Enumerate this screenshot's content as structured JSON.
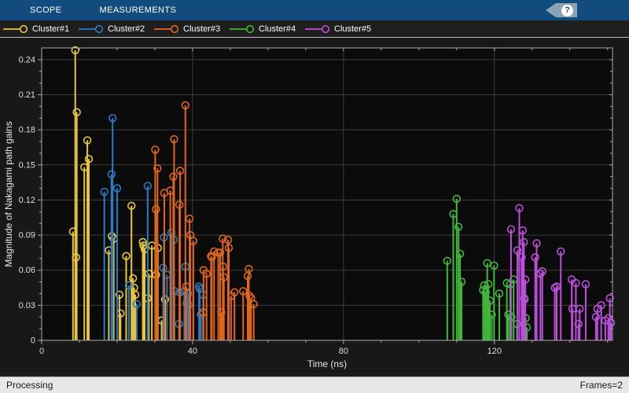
{
  "toolstrip": {
    "tabs": [
      {
        "label": "SCOPE"
      },
      {
        "label": "MEASUREMENTS"
      }
    ],
    "help_label": "?"
  },
  "legend": {
    "items": [
      {
        "label": "Cluster#1",
        "color": "#E7C53E"
      },
      {
        "label": "Cluster#2",
        "color": "#2B7BC4"
      },
      {
        "label": "Cluster#3",
        "color": "#E0661E"
      },
      {
        "label": "Cluster#4",
        "color": "#41B83C"
      },
      {
        "label": "Cluster#5",
        "color": "#BC4FDB"
      }
    ]
  },
  "status_bar": {
    "left": "Processing",
    "right": "Frames=2"
  },
  "chart_data": {
    "type": "stem",
    "title": "",
    "xlabel": "Time (ns)",
    "ylabel": "Magnitude of Nakagami path gains",
    "xlim": [
      0,
      151.3
    ],
    "ylim": [
      0,
      0.25
    ],
    "xticks": [
      0,
      40,
      80,
      120
    ],
    "yticks": [
      0,
      0.03,
      0.06,
      0.09,
      0.12,
      0.15,
      0.18,
      0.21,
      0.24
    ],
    "x_minor_step": 10,
    "y_minor_step": 0.01,
    "grid": true,
    "legend_position": "top",
    "colors": {
      "plot_bg": "#0B0B0B",
      "grid": "#3D3D3D",
      "axis": "#ABABAB",
      "tick_label": "#DEDEDE",
      "axis_label": "#E8E8E8"
    },
    "series": [
      {
        "name": "Cluster#1",
        "color": "#E7C53E",
        "points": [
          [
            8.3,
            0.093
          ],
          [
            8.9,
            0.248
          ],
          [
            9.1,
            0.071
          ],
          [
            9.3,
            0.195
          ],
          [
            11.3,
            0.148
          ],
          [
            12.1,
            0.171
          ],
          [
            12.5,
            0.155
          ],
          [
            17.8,
            0.077
          ],
          [
            18.6,
            0.089
          ],
          [
            19.1,
            0.087
          ],
          [
            20.6,
            0.039
          ],
          [
            20.9,
            0.023
          ],
          [
            22.4,
            0.072
          ],
          [
            23.8,
            0.115
          ],
          [
            24.2,
            0.053
          ],
          [
            24.5,
            0.045
          ],
          [
            24.8,
            0.039
          ],
          [
            26.8,
            0.084
          ],
          [
            27.0,
            0.081
          ],
          [
            27.3,
            0.078
          ],
          [
            28.1,
            0.036
          ],
          [
            28.4,
            0.057
          ],
          [
            29.2,
            0.081
          ],
          [
            30.3,
            0.056
          ],
          [
            30.8,
            0.079
          ],
          [
            31.8,
            0.017
          ],
          [
            32.7,
            0.035
          ]
        ]
      },
      {
        "name": "Cluster#2",
        "color": "#2B7BC4",
        "points": [
          [
            16.6,
            0.127
          ],
          [
            18.5,
            0.142
          ],
          [
            18.8,
            0.19
          ],
          [
            20.0,
            0.13
          ],
          [
            23.1,
            0.047
          ],
          [
            25.2,
            0.031
          ],
          [
            28.1,
            0.132
          ],
          [
            32.2,
            0.062
          ],
          [
            32.4,
            0.088
          ],
          [
            33.2,
            0.056
          ],
          [
            34.4,
            0.092
          ],
          [
            35.0,
            0.086
          ],
          [
            35.2,
            0.042
          ],
          [
            36.4,
            0.014
          ],
          [
            36.6,
            0.041
          ],
          [
            37.8,
            0.042
          ],
          [
            38.1,
            0.063
          ],
          [
            38.4,
            0.032
          ],
          [
            38.8,
            0.04
          ],
          [
            39.0,
            0.03
          ],
          [
            41.7,
            0.046
          ],
          [
            41.9,
            0.044
          ],
          [
            42.2,
            0.022
          ],
          [
            42.8,
            0.039
          ]
        ]
      },
      {
        "name": "Cluster#3",
        "color": "#E0661E",
        "points": [
          [
            30.1,
            0.163
          ],
          [
            30.3,
            0.112
          ],
          [
            30.7,
            0.147
          ],
          [
            32.5,
            0.126
          ],
          [
            34.1,
            0.128
          ],
          [
            34.9,
            0.14
          ],
          [
            35.1,
            0.172
          ],
          [
            36.5,
            0.116
          ],
          [
            36.7,
            0.145
          ],
          [
            38.1,
            0.201
          ],
          [
            38.3,
            0.046
          ],
          [
            39.2,
            0.104
          ],
          [
            39.4,
            0.09
          ],
          [
            40.2,
            0.085
          ],
          [
            42.8,
            0.024
          ],
          [
            42.9,
            0.06
          ],
          [
            43.7,
            0.057
          ],
          [
            44.9,
            0.072
          ],
          [
            45.1,
            0.071
          ],
          [
            45.7,
            0.076
          ],
          [
            46.8,
            0.075
          ],
          [
            47.3,
            0.075
          ],
          [
            47.6,
            0.024
          ],
          [
            48.0,
            0.087
          ],
          [
            48.1,
            0.063
          ],
          [
            48.3,
            0.054
          ],
          [
            49.4,
            0.086
          ],
          [
            49.6,
            0.079
          ],
          [
            50.2,
            0.038
          ],
          [
            51.1,
            0.041
          ],
          [
            53.4,
            0.042
          ],
          [
            54.6,
            0.055
          ],
          [
            54.9,
            0.061
          ],
          [
            55.1,
            0.038
          ],
          [
            55.5,
            0.036
          ],
          [
            56.2,
            0.031
          ]
        ]
      },
      {
        "name": "Cluster#4",
        "color": "#41B83C",
        "points": [
          [
            107.5,
            0.068
          ],
          [
            109.1,
            0.108
          ],
          [
            110.0,
            0.121
          ],
          [
            110.5,
            0.097
          ],
          [
            110.9,
            0.074
          ],
          [
            111.3,
            0.05
          ],
          [
            117.0,
            0.043
          ],
          [
            117.3,
            0.047
          ],
          [
            117.7,
            0.041
          ],
          [
            118.1,
            0.066
          ],
          [
            118.4,
            0.048
          ],
          [
            118.8,
            0.034
          ],
          [
            119.3,
            0.022
          ],
          [
            119.9,
            0.064
          ],
          [
            121.3,
            0.04
          ],
          [
            123.3,
            0.049
          ],
          [
            123.7,
            0.022
          ],
          [
            124.2,
            0.048
          ],
          [
            124.5,
            0.02
          ],
          [
            125.1,
            0.052
          ],
          [
            126.0,
            0.014
          ],
          [
            127.9,
            0.036
          ],
          [
            128.3,
            0.019
          ],
          [
            128.6,
            0.011
          ]
        ]
      },
      {
        "name": "Cluster#5",
        "color": "#BC4FDB",
        "points": [
          [
            124.4,
            0.095
          ],
          [
            126.1,
            0.077
          ],
          [
            126.6,
            0.113
          ],
          [
            127.2,
            0.071
          ],
          [
            127.5,
            0.094
          ],
          [
            127.8,
            0.084
          ],
          [
            128.0,
            0.035
          ],
          [
            128.2,
            0.052
          ],
          [
            130.8,
            0.071
          ],
          [
            131.2,
            0.083
          ],
          [
            132.2,
            0.057
          ],
          [
            132.7,
            0.059
          ],
          [
            136.0,
            0.045
          ],
          [
            136.5,
            0.046
          ],
          [
            137.6,
            0.076
          ],
          [
            140.5,
            0.052
          ],
          [
            140.7,
            0.027
          ],
          [
            141.6,
            0.049
          ],
          [
            142.3,
            0.014
          ],
          [
            142.6,
            0.027
          ],
          [
            144.2,
            0.048
          ],
          [
            146.9,
            0.02
          ],
          [
            147.3,
            0.027
          ],
          [
            148.3,
            0.03
          ],
          [
            149.4,
            0.017
          ],
          [
            150.2,
            0.019
          ],
          [
            150.6,
            0.036
          ],
          [
            150.9,
            0.015
          ]
        ]
      }
    ]
  }
}
